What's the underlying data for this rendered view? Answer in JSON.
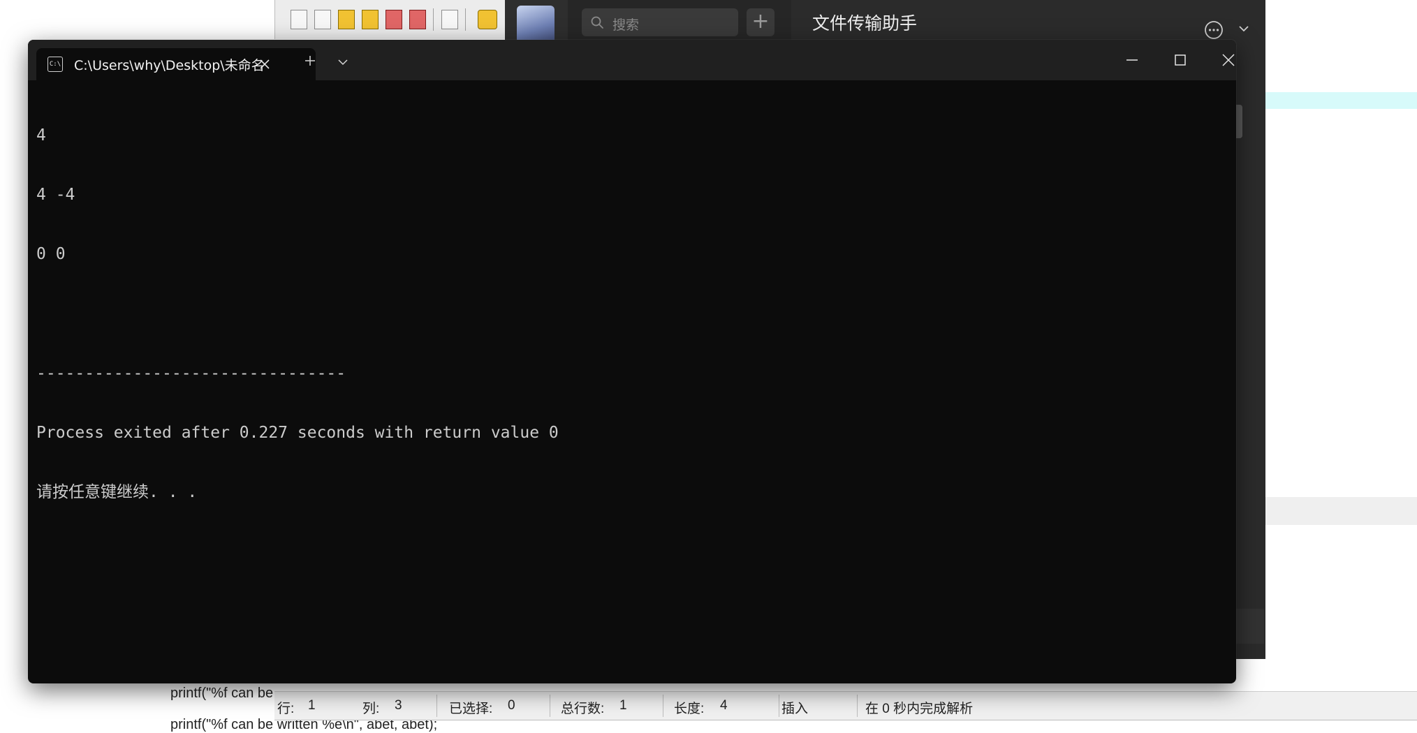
{
  "background_editor": {
    "line1": "printf(\"%f can be",
    "line2": "printf(\"%f can be written %e\\n\", abet, abet);"
  },
  "ide_status": {
    "row_label": "行:",
    "row_value": "1",
    "col_label": "列:",
    "col_value": "3",
    "selected_label": "已选择:",
    "selected_value": "0",
    "total_label": "总行数:",
    "total_value": "1",
    "length_label": "长度:",
    "length_value": "4",
    "mode": "插入",
    "parse_message": "在 0 秒内完成解析"
  },
  "wechat": {
    "search_placeholder": "搜索",
    "add_label": "+",
    "chat_title": "文件传输助手",
    "icons": [
      "avatar",
      "search-icon",
      "more-icon",
      "chevron-down-icon"
    ]
  },
  "terminal": {
    "tab_icon_text": "C:\\",
    "tab_title": "C:\\Users\\why\\Desktop\\未命名",
    "lines": [
      "4",
      "4 -4",
      "0 0",
      "",
      "--------------------------------",
      "Process exited after 0.227 seconds with return value 0",
      "请按任意键继续. . ."
    ],
    "colors": {
      "background": "#0c0c0c",
      "text": "#cccccc",
      "titlebar": "#202020"
    }
  }
}
